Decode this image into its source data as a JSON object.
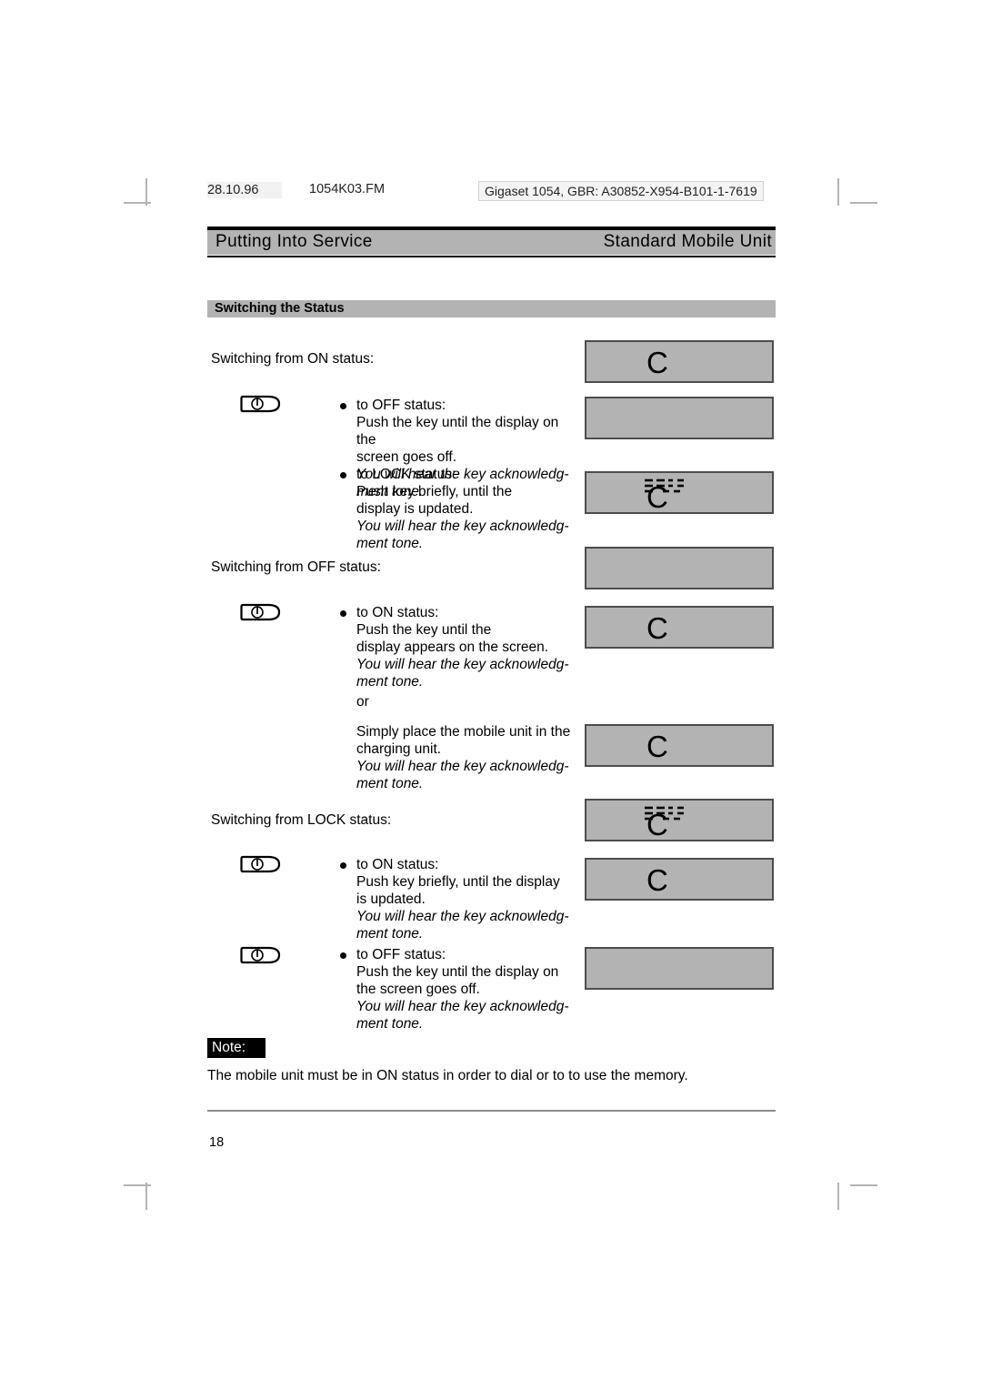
{
  "runhead": {
    "date": "28.10.96",
    "filename": "1054K03.FM",
    "part_number": "Gigaset 1054, GBR: A30852-X954-B101-1-7619"
  },
  "header": {
    "left_title": "Putting Into Service",
    "right_title": "Standard Mobile Unit"
  },
  "section": {
    "title": "Switching the Status"
  },
  "groups": {
    "on": {
      "lead": "Switching from ON status:",
      "items": [
        {
          "bullet": "to OFF status:",
          "lines": "Push the key until the display on the\nscreen goes off.",
          "italic": "You will hear the key acknowledg-\nment tone."
        },
        {
          "bullet": "to LOCK status:",
          "lines": "Push key briefly, until the\ndisplay is updated.",
          "italic": "You will hear the key acknowledg-\nment tone."
        }
      ]
    },
    "off": {
      "lead": "Switching from OFF status:",
      "items": [
        {
          "bullet": "to ON status:",
          "lines": "Push the key until the\ndisplay appears on the screen.",
          "italic": "You will hear the key acknowledg-\nment tone."
        }
      ],
      "or_label": "or",
      "alternative": {
        "lines": "Simply place the mobile unit in the\ncharging unit.",
        "italic": "You will hear the key acknowledg-\nment tone."
      }
    },
    "lock": {
      "lead": "Switching from LOCK status:",
      "items": [
        {
          "bullet": "to ON status:",
          "lines": "Push key briefly, until the display\nis updated.",
          "italic": "You will hear the key acknowledg-\nment tone."
        },
        {
          "bullet": "to OFF status:",
          "lines": "Push the key until the display on\nthe screen goes off.",
          "italic": "You will hear the key acknowledg-\nment tone."
        }
      ]
    }
  },
  "displays": [
    {
      "state": "on",
      "glyph": "C"
    },
    {
      "state": "off",
      "glyph": ""
    },
    {
      "state": "lock",
      "glyph": "C"
    },
    {
      "state": "off",
      "glyph": ""
    },
    {
      "state": "on",
      "glyph": "C"
    },
    {
      "state": "on",
      "glyph": "C"
    },
    {
      "state": "lock",
      "glyph": "C"
    },
    {
      "state": "on",
      "glyph": "C"
    },
    {
      "state": "off",
      "glyph": ""
    }
  ],
  "note": {
    "label": "Note:",
    "text": "The mobile unit must be in ON status in order to dial or to to use the memory."
  },
  "footer": {
    "page_number": "18"
  },
  "colors": {
    "band_gray": "#b3b3b3",
    "lcd_border": "#4d4d4d",
    "rule_black": "#000000",
    "footer_rule": "#8c8c8c"
  }
}
